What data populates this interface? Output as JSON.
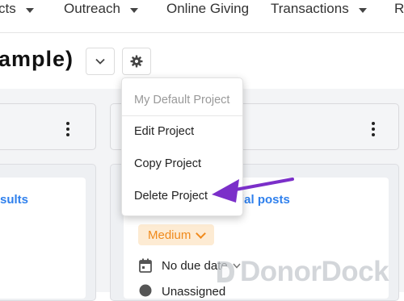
{
  "nav": {
    "items": [
      {
        "label": "cts"
      },
      {
        "label": "Outreach"
      },
      {
        "label": "Online Giving"
      },
      {
        "label": "Transactions"
      },
      {
        "label": "R"
      }
    ]
  },
  "page": {
    "title": "ample)"
  },
  "dropdown": {
    "header": "My Default Project",
    "items": [
      "Edit Project",
      "Copy Project",
      "Delete Project"
    ]
  },
  "cards": {
    "left_link": "sults",
    "right_link": "ial posts",
    "priority": "Medium",
    "due": "No due date",
    "assignee": "Unassigned"
  },
  "watermark": "DonorDock",
  "colors": {
    "link": "#2f80ed",
    "priority_bg": "#fdebd3",
    "priority_text": "#f08a1c",
    "annotation_arrow": "#7b2fc9"
  },
  "icons": [
    "chevron-down-icon",
    "gear-icon",
    "kebab-menu-icon",
    "calendar-icon",
    "user-icon",
    "arrow-annotation-icon"
  ]
}
